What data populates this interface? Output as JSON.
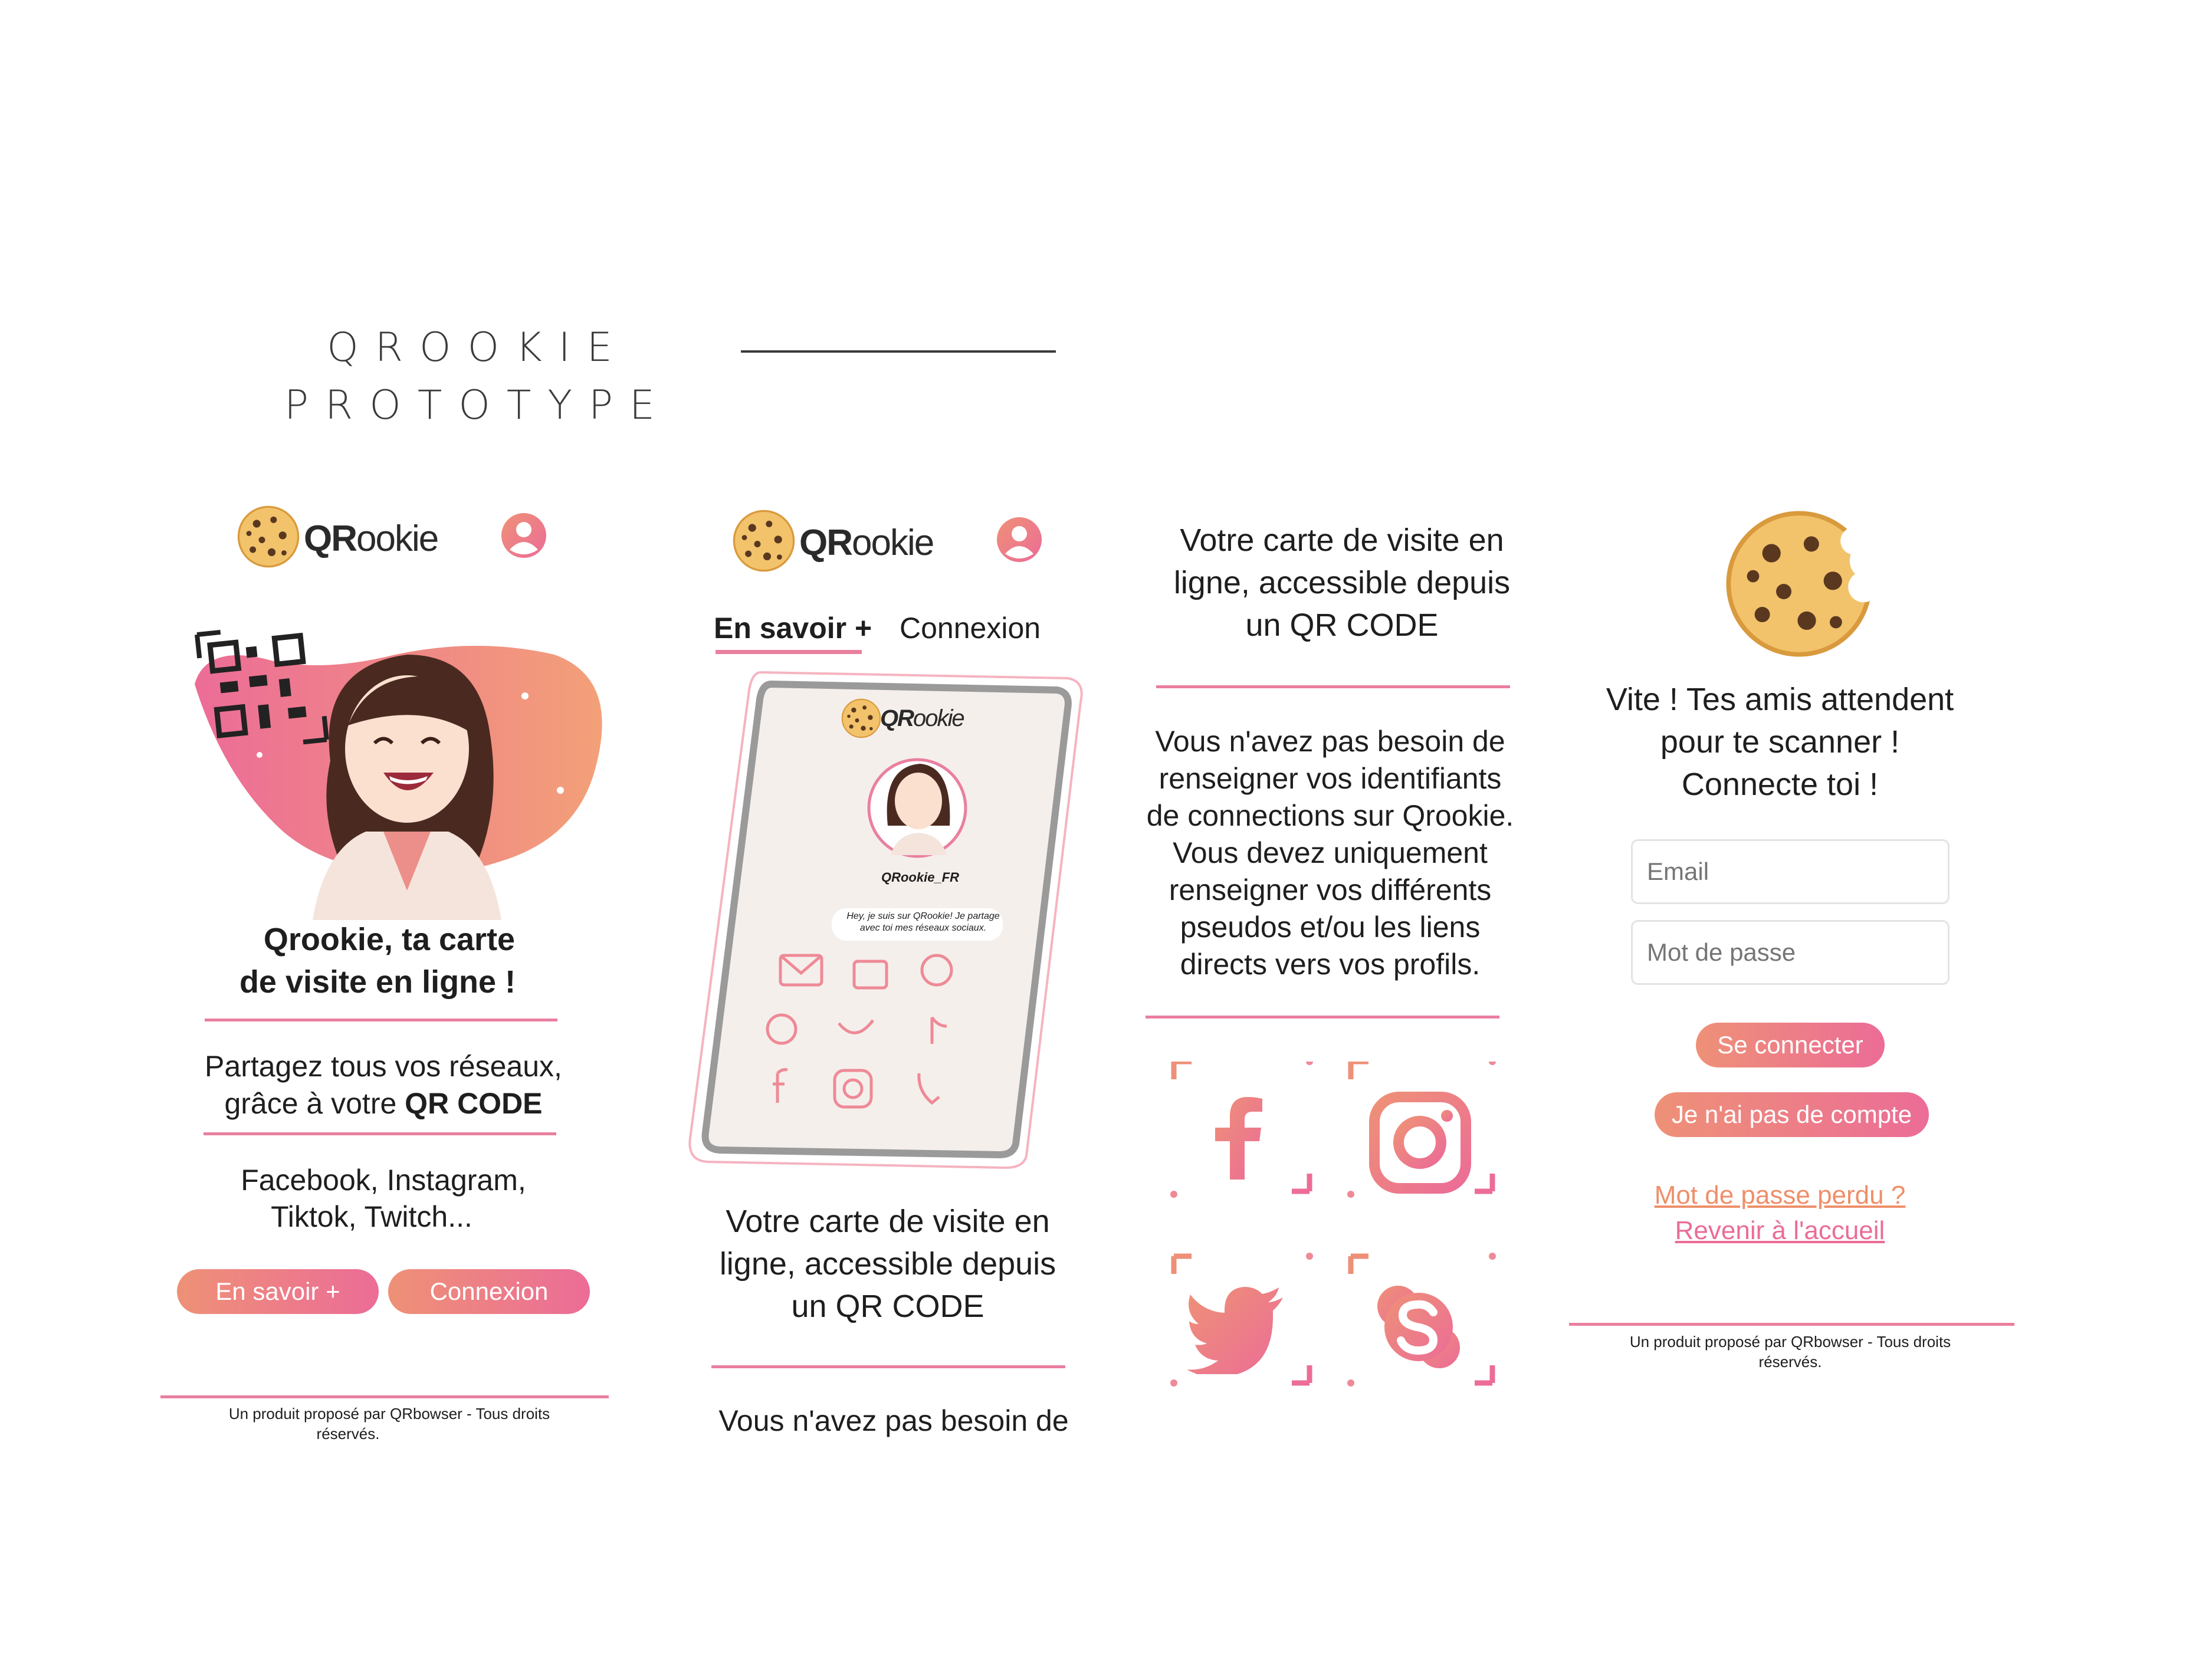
{
  "heading": {
    "line1": "QROOKIE",
    "line2": "PROTOTYPE"
  },
  "brand": {
    "bold": "QR",
    "rest": "ookie"
  },
  "screen1": {
    "title_line1": "Qrookie, ta carte",
    "title_line2": "de visite en ligne !",
    "share_line1": "Partagez tous vos réseaux,",
    "share_line2_prefix": "grâce à votre ",
    "share_line2_bold": "QR CODE",
    "networks_line1": "Facebook, Instagram,",
    "networks_line2": "Tiktok, Twitch...",
    "btn_more": "En savoir +",
    "btn_login": "Connexion",
    "footer_line1": "Un produit proposé par QRbowser - Tous droits",
    "footer_line2": "réservés."
  },
  "screen2": {
    "tab_more": "En savoir +",
    "tab_login": "Connexion",
    "phone_username": "QRookie_FR",
    "phone_bio_line1": "Hey, je suis sur QRookie! Je partage",
    "phone_bio_line2": "avec toi mes réseaux sociaux.",
    "text_line1": "Votre carte de visite en",
    "text_line2": "ligne, accessible depuis",
    "text_line3": "un QR CODE",
    "text_cut": "Vous n'avez pas besoin de"
  },
  "screen3": {
    "text_line1": "Votre carte de visite en",
    "text_line2": "ligne, accessible depuis",
    "text_line3": "un QR CODE",
    "para_lines": [
      "Vous n'avez pas besoin de",
      "renseigner vos identifiants",
      "de connections sur Qrookie.",
      "Vous devez uniquement",
      "renseigner vos différents",
      "pseudos et/ou les liens",
      "directs vers vos profils."
    ],
    "icons": [
      "facebook-icon",
      "instagram-icon",
      "twitter-icon",
      "skype-icon"
    ]
  },
  "screen4": {
    "msg_line1": "Vite ! Tes amis attendent",
    "msg_line2": "pour te scanner !",
    "msg_line3": "Connecte toi !",
    "email_placeholder": "Email",
    "password_placeholder": "Mot de passe",
    "btn_connect": "Se connecter",
    "btn_no_account": "Je n'ai pas de compte",
    "link_lost_password": "Mot de passe perdu ?",
    "link_home": "Revenir à l'accueil",
    "footer_line1": "Un produit proposé par QRbowser - Tous droits",
    "footer_line2": "réservés."
  },
  "colors": {
    "pink": "#ec6c97",
    "orange": "#ee9177",
    "rule": "#ea7fa0"
  }
}
